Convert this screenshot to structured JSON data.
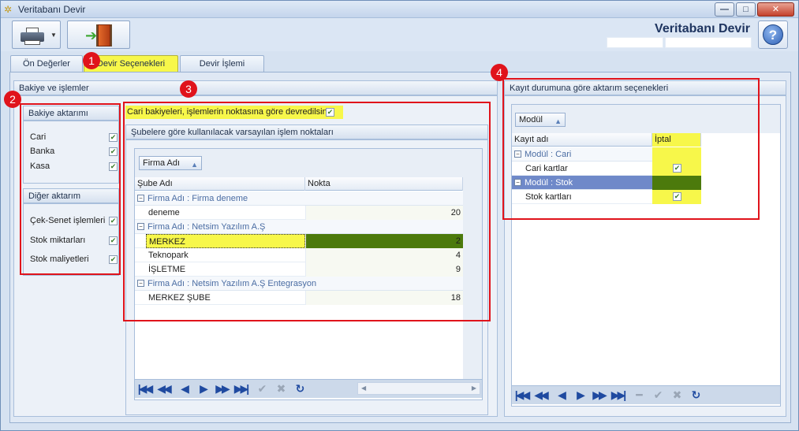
{
  "window": {
    "title": "Veritabanı Devir"
  },
  "header": {
    "title": "Veritabanı Devir",
    "help_label": "?"
  },
  "tabs": [
    {
      "label": "Ön Değerler"
    },
    {
      "label": "Devir Seçenekleri"
    },
    {
      "label": "Devir İşlemi"
    }
  ],
  "markers": [
    "1",
    "2",
    "3",
    "4"
  ],
  "left_section": {
    "title": "Bakiye ve işlemler",
    "bakiye": {
      "title": "Bakiye aktarımı",
      "items": [
        {
          "label": "Cari",
          "checked": true
        },
        {
          "label": "Banka",
          "checked": true
        },
        {
          "label": "Kasa",
          "checked": true
        }
      ]
    },
    "diger": {
      "title": "Diğer aktarım",
      "items": [
        {
          "label": "Çek-Senet işlemleri",
          "checked": true
        },
        {
          "label": "Stok miktarları",
          "checked": true
        },
        {
          "label": "Stok maliyetleri",
          "checked": true
        }
      ]
    }
  },
  "middle_section": {
    "cari_option": {
      "label": "Cari bakiyeleri, işlemlerin noktasına göre devredilsin",
      "checked": true
    },
    "title": "Şubelere göre kullanılacak varsayılan işlem noktaları",
    "groupby": "Firma Adı",
    "columns": [
      "Şube Adı",
      "Nokta"
    ],
    "groups": [
      {
        "label": "Firma Adı : Firma deneme",
        "rows": [
          {
            "name": "deneme",
            "value": "20"
          }
        ]
      },
      {
        "label": "Firma Adı : Netsim Yazılım A.Ş",
        "rows": [
          {
            "name": "MERKEZ",
            "value": "2",
            "selected": true
          },
          {
            "name": "Teknopark",
            "value": "4"
          },
          {
            "name": "İŞLETME",
            "value": "9"
          }
        ]
      },
      {
        "label": "Firma Adı : Netsim Yazılım A.Ş Entegrasyon",
        "rows": [
          {
            "name": "MERKEZ ŞUBE",
            "value": "18"
          }
        ]
      }
    ]
  },
  "right_section": {
    "title": "Kayıt durumuna göre aktarım seçenekleri",
    "groupby": "Modül",
    "columns": [
      "Kayıt adı",
      "İptal"
    ],
    "groups": [
      {
        "label": "Modül : Cari",
        "rows": [
          {
            "name": "Cari kartlar",
            "checked": true
          }
        ]
      },
      {
        "label": "Modül : Stok",
        "selected": true,
        "rows": [
          {
            "name": "Stok kartları",
            "checked": true
          }
        ]
      }
    ]
  },
  "colors": {
    "highlight": "#f7f74a",
    "selected_row": "#4c7a0c",
    "annotation": "#e0131b"
  }
}
